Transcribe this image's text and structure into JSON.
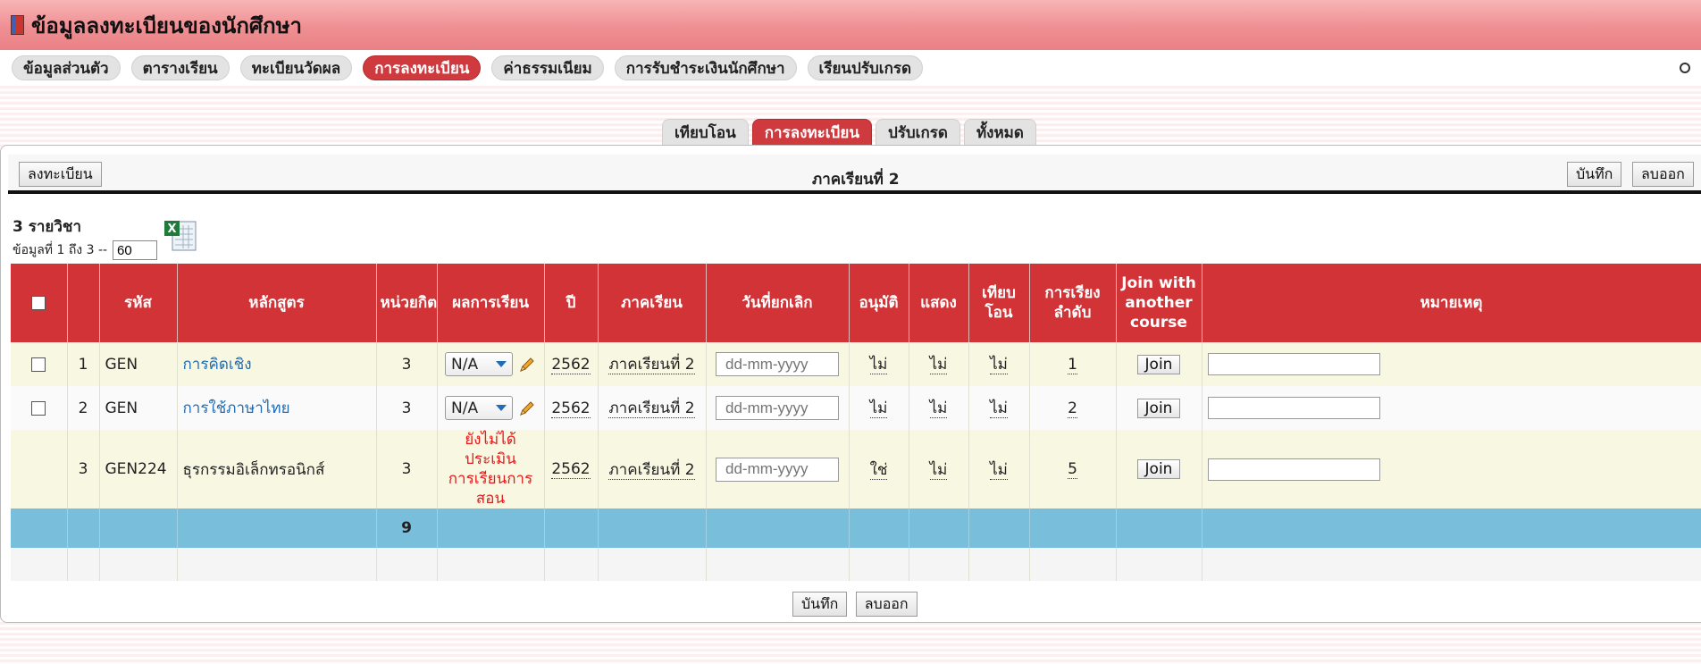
{
  "header": {
    "title": "ข้อมูลลงทะเบียนของนักศึกษา"
  },
  "mainnav": {
    "items": [
      {
        "label": "ข้อมูลส่วนตัว"
      },
      {
        "label": "ตารางเรียน"
      },
      {
        "label": "ทะเบียนวัดผล"
      },
      {
        "label": "การลงทะเบียน",
        "active": true
      },
      {
        "label": "ค่าธรรมเนียม"
      },
      {
        "label": "การรับชำระเงินนักศึกษา"
      },
      {
        "label": "เรียนปรับเกรด"
      }
    ]
  },
  "subtabs": [
    {
      "label": "เทียบโอน"
    },
    {
      "label": "การลงทะเบียน",
      "active": true
    },
    {
      "label": "ปรับเกรด"
    },
    {
      "label": "ทั้งหมด"
    }
  ],
  "toolbar": {
    "register_label": "ลงทะเบียน",
    "semester_title": "ภาคเรียนที่ 2",
    "save_label": "บันทึก",
    "delete_label": "ลบออก"
  },
  "summary": {
    "count_label": "3 รายวิชา",
    "range_label": "ข้อมูลที่ 1 ถึง 3 --",
    "page_size": "60"
  },
  "table": {
    "headers": {
      "no": "",
      "code": "รหัส",
      "course": "หลักสูตร",
      "credits": "หน่วยกิต",
      "result": "ผลการเรียน",
      "year": "ปี",
      "semester": "ภาคเรียน",
      "cancel_date": "วันที่ยกเลิก",
      "approve": "อนุมัติ",
      "show": "แสดง",
      "transfer": "เทียบโอน",
      "order": "การเรียงลำดับ",
      "join": "Join with another course",
      "note": "หมายเหตุ"
    },
    "rows": [
      {
        "no": "1",
        "code": "GEN",
        "course": "การคิดเชิง",
        "credits": "3",
        "result": "N/A",
        "year": "2562",
        "semester": "ภาคเรียนที่ 2",
        "date_placeholder": "dd-mm-yyyy",
        "approve": "ไม่",
        "show": "ไม่",
        "transfer": "ไม่",
        "order": "1",
        "join": "Join"
      },
      {
        "no": "2",
        "code": "GEN",
        "course": "การใช้ภาษาไทย",
        "credits": "3",
        "result": "N/A",
        "year": "2562",
        "semester": "ภาคเรียนที่ 2",
        "date_placeholder": "dd-mm-yyyy",
        "approve": "ไม่",
        "show": "ไม่",
        "transfer": "ไม่",
        "order": "2",
        "join": "Join"
      },
      {
        "no": "3",
        "code": "GEN224",
        "course": "ธุรกรรมอิเล็กทรอนิกส์",
        "credits": "3",
        "result_line1": "ยังไม่ได้ประเมิน",
        "result_line2": "การเรียนการสอน",
        "year": "2562",
        "semester": "ภาคเรียนที่ 2",
        "date_placeholder": "dd-mm-yyyy",
        "approve": "ใช่",
        "show": "ไม่",
        "transfer": "ไม่",
        "order": "5",
        "join": "Join"
      }
    ],
    "total_credits": "9"
  },
  "colors": {
    "accent": "#d23337",
    "total_row": "#79bfdc",
    "link": "#1f6db5",
    "warning": "#e41b1b"
  }
}
